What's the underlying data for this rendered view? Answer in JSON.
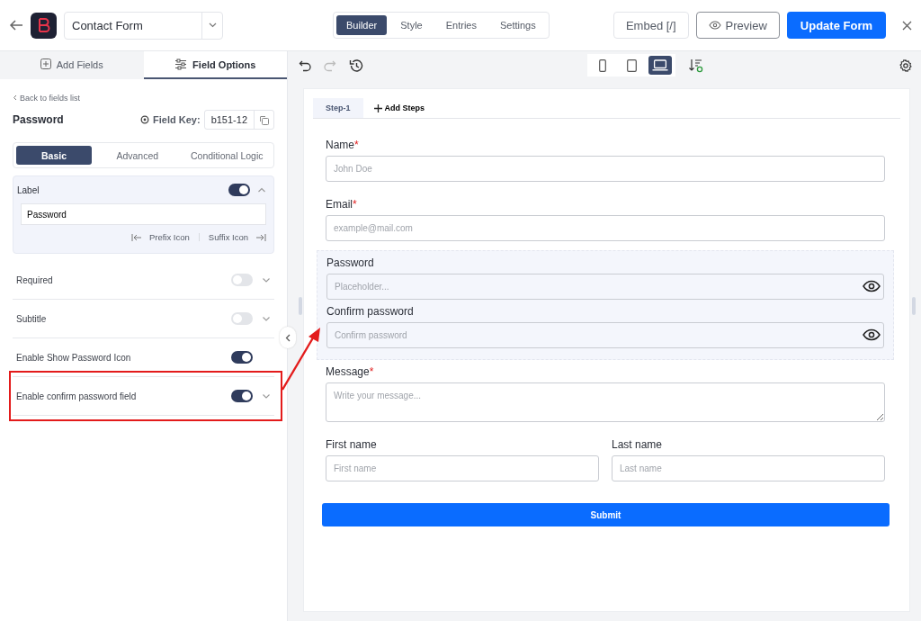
{
  "header": {
    "form_name": "Contact Form",
    "nav_tabs": [
      {
        "label": "Builder",
        "selected": true
      },
      {
        "label": "Style",
        "selected": false
      },
      {
        "label": "Entries",
        "selected": false
      },
      {
        "label": "Settings",
        "selected": false
      }
    ],
    "embed": "Embed [/]",
    "preview": "Preview",
    "update": "Update Form"
  },
  "sidebar": {
    "tabs": [
      {
        "label": "Add Fields",
        "kind": "add",
        "selected": false
      },
      {
        "label": "Field Options",
        "kind": "options",
        "selected": true
      }
    ],
    "back_link": "Back to fields list",
    "field_title": "Password",
    "field_key_label": "Field Key:",
    "field_key_value": "b151-12",
    "subtabs": [
      {
        "label": "Basic",
        "selected": true
      },
      {
        "label": "Advanced",
        "selected": false
      },
      {
        "label": "Conditional Logic",
        "selected": false
      }
    ],
    "label_section": {
      "title": "Label",
      "on": true,
      "expanded": true,
      "value": "Password",
      "prefix": "Prefix Icon",
      "suffix": "Suffix Icon"
    },
    "options": [
      {
        "label": "Required",
        "on": false,
        "expandable": true,
        "highlighted": false
      },
      {
        "label": "Subtitle",
        "on": false,
        "expandable": true,
        "highlighted": false
      },
      {
        "label": "Enable Show Password Icon",
        "on": true,
        "expandable": false,
        "highlighted": false
      },
      {
        "label": "Enable confirm password field",
        "on": true,
        "expandable": true,
        "highlighted": true
      }
    ]
  },
  "toolbar": {
    "devices": [
      {
        "kind": "mobile",
        "selected": false
      },
      {
        "kind": "tablet",
        "selected": false
      },
      {
        "kind": "desktop",
        "selected": true
      }
    ]
  },
  "form": {
    "steps": [
      {
        "label": "Step-1",
        "selected": true
      }
    ],
    "add_steps": "Add Steps",
    "blocks": [
      {
        "selected": false,
        "kind": "stack",
        "fields": [
          {
            "kind": "input",
            "label": "Name",
            "required_mark": "*",
            "placeholder": "John Doe"
          }
        ]
      },
      {
        "selected": false,
        "kind": "stack",
        "fields": [
          {
            "kind": "input",
            "label": "Email",
            "required_mark": "*",
            "placeholder": "example@mail.com"
          }
        ]
      },
      {
        "selected": true,
        "kind": "stack",
        "fields": [
          {
            "kind": "password",
            "label": "Password",
            "placeholder": "Placeholder..."
          },
          {
            "kind": "password",
            "label": "Confirm password",
            "placeholder": "Confirm password"
          }
        ]
      },
      {
        "selected": false,
        "kind": "stack",
        "fields": [
          {
            "kind": "textarea",
            "label": "Message",
            "required_mark": "*",
            "placeholder": "Write your message..."
          }
        ]
      },
      {
        "selected": false,
        "kind": "columns",
        "fields": [
          {
            "kind": "input",
            "label": "First name",
            "placeholder": "First name"
          },
          {
            "kind": "input",
            "label": "Last name",
            "placeholder": "Last name"
          }
        ]
      }
    ],
    "submit": "Submit"
  }
}
